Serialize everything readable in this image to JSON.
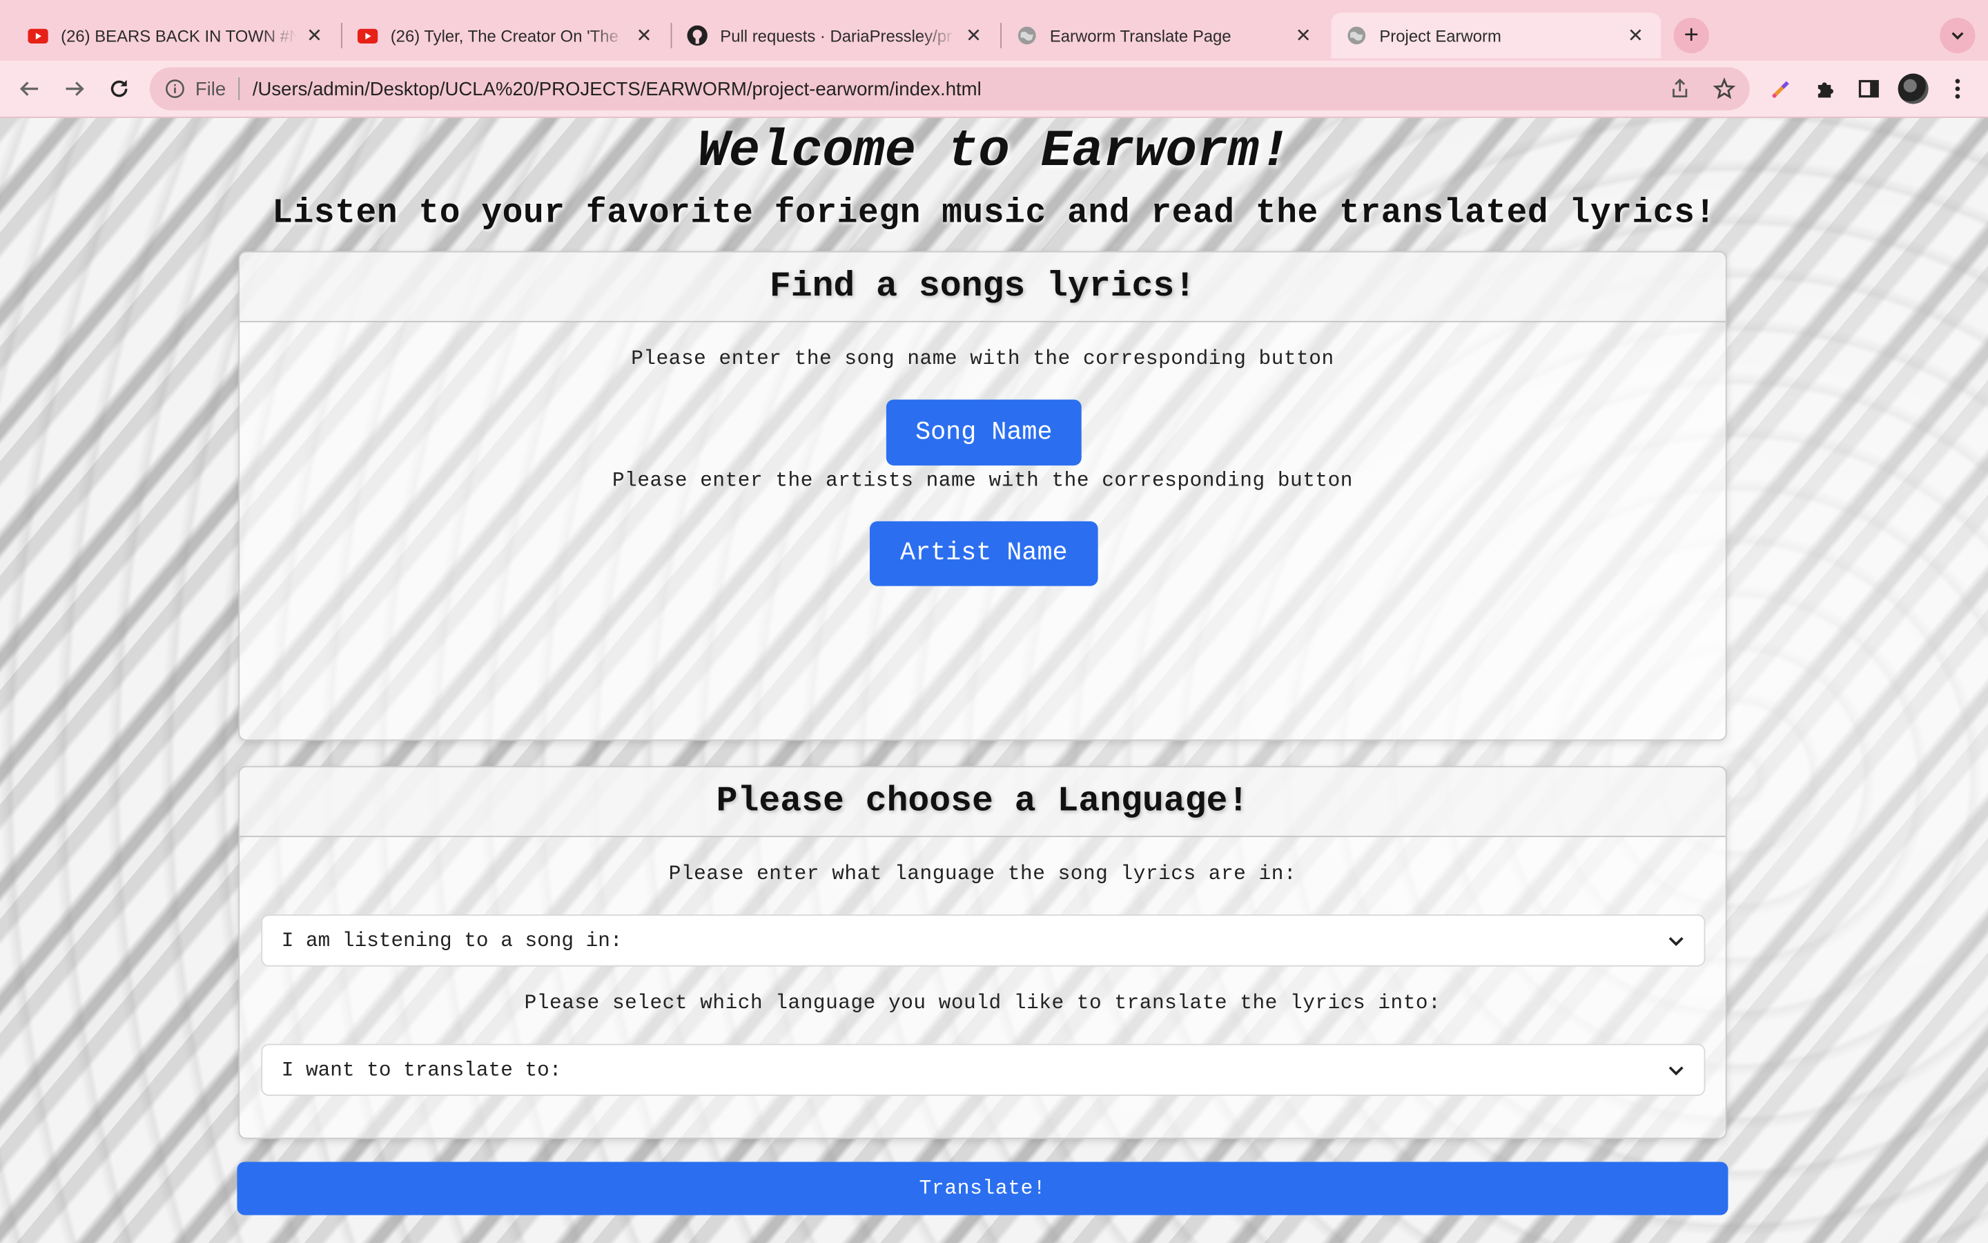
{
  "browser": {
    "tabs": [
      {
        "title": "(26) BEARS BACK IN TOWN #N",
        "icon": "youtube-icon",
        "active": false
      },
      {
        "title": "(26) Tyler, The Creator On 'The",
        "icon": "youtube-icon",
        "active": false
      },
      {
        "title": "Pull requests · DariaPressley/pr",
        "icon": "github-icon",
        "active": false
      },
      {
        "title": "Earworm Translate Page",
        "icon": "globe-icon",
        "active": false
      },
      {
        "title": "Project Earworm",
        "icon": "globe-icon",
        "active": true
      }
    ],
    "address": {
      "scheme": "File",
      "url": "/Users/admin/Desktop/UCLA%20/PROJECTS/EARWORM/project-earworm/index.html"
    },
    "theme_color": "#f8d0da",
    "toolbar_icons": [
      "back-icon",
      "forward-icon",
      "reload-icon",
      "info-icon",
      "share-icon",
      "bookmark-star-icon",
      "color-picker-extension-icon",
      "extensions-puzzle-icon",
      "side-panel-icon",
      "avatar",
      "more-menu-icon"
    ]
  },
  "page": {
    "title": "Welcome to Earworm!",
    "subtitle": "Listen to your favorite foriegn music and read the translated lyrics!",
    "lyrics_card": {
      "heading": "Find a songs lyrics!",
      "song_prompt": "Please enter the song name with the corresponding button",
      "song_button": "Song Name",
      "artist_prompt": "Please enter the artists name with the corresponding button",
      "artist_button": "Artist Name"
    },
    "language_card": {
      "heading": "Please choose a Language!",
      "source_prompt": "Please enter what language the song lyrics are in:",
      "source_select": "I am listening to a song in:",
      "target_prompt": "Please select which language you would like to translate the lyrics into:",
      "target_select": "I want to translate to:"
    },
    "translate_button": "Translate!",
    "accent_color": "#2b6ff0"
  }
}
